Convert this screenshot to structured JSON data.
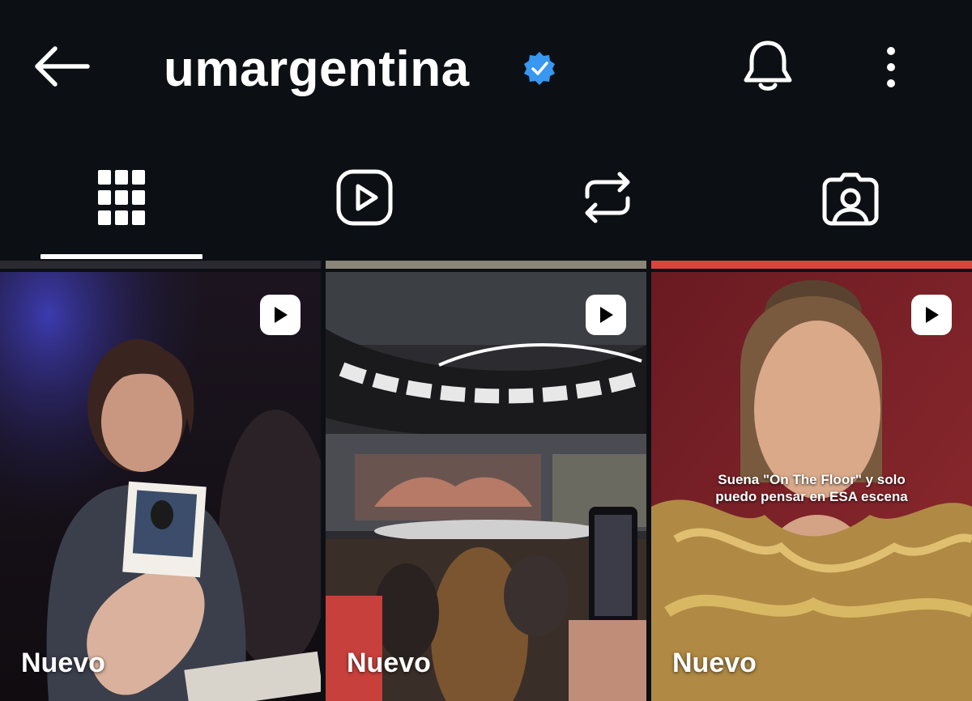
{
  "header": {
    "username": "umargentina",
    "verified_color": "#3897f0",
    "icons": {
      "back": "arrow-left-icon",
      "bell": "bell-icon",
      "more": "more-vertical-icon"
    }
  },
  "tabs": [
    {
      "name": "posts",
      "icon": "grid-icon",
      "active": true
    },
    {
      "name": "reels",
      "icon": "reels-icon",
      "active": false
    },
    {
      "name": "reposts",
      "icon": "repost-icon",
      "active": false
    },
    {
      "name": "tagged",
      "icon": "tagged-icon",
      "active": false
    }
  ],
  "grid": {
    "items": [
      {
        "label": "Nuevo",
        "type": "reel",
        "caption": ""
      },
      {
        "label": "Nuevo",
        "type": "reel",
        "caption": ""
      },
      {
        "label": "Nuevo",
        "type": "reel",
        "caption": "Suena \"On The Floor\" y solo puedo pensar en ESA escena"
      }
    ]
  }
}
